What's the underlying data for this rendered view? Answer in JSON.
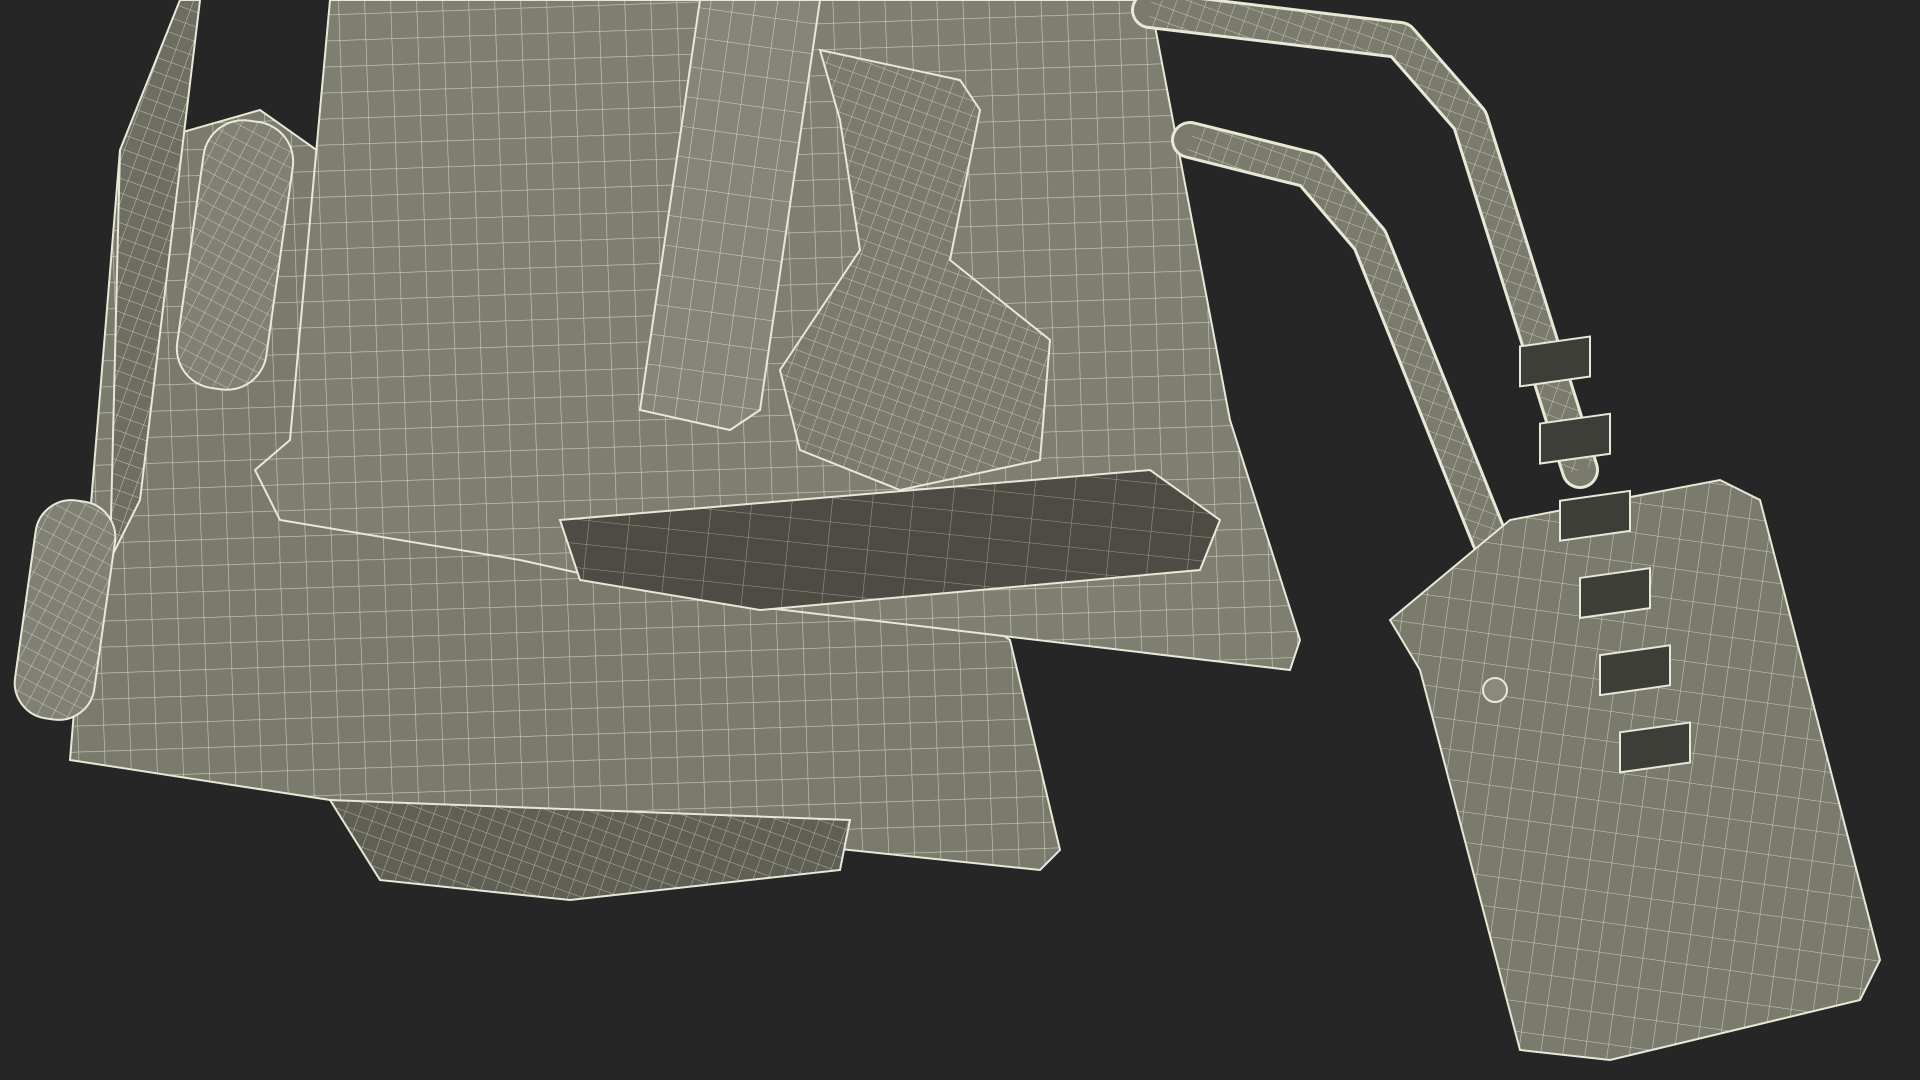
{
  "scene": {
    "background": "#262626",
    "surface_fill": "#7a7a6d",
    "surface_fill_dark": "#5f5f55",
    "surface_fill_light": "#8a8a7c",
    "wire_color": "#e8e8d8",
    "shadow_fill": "#3e3e38"
  }
}
